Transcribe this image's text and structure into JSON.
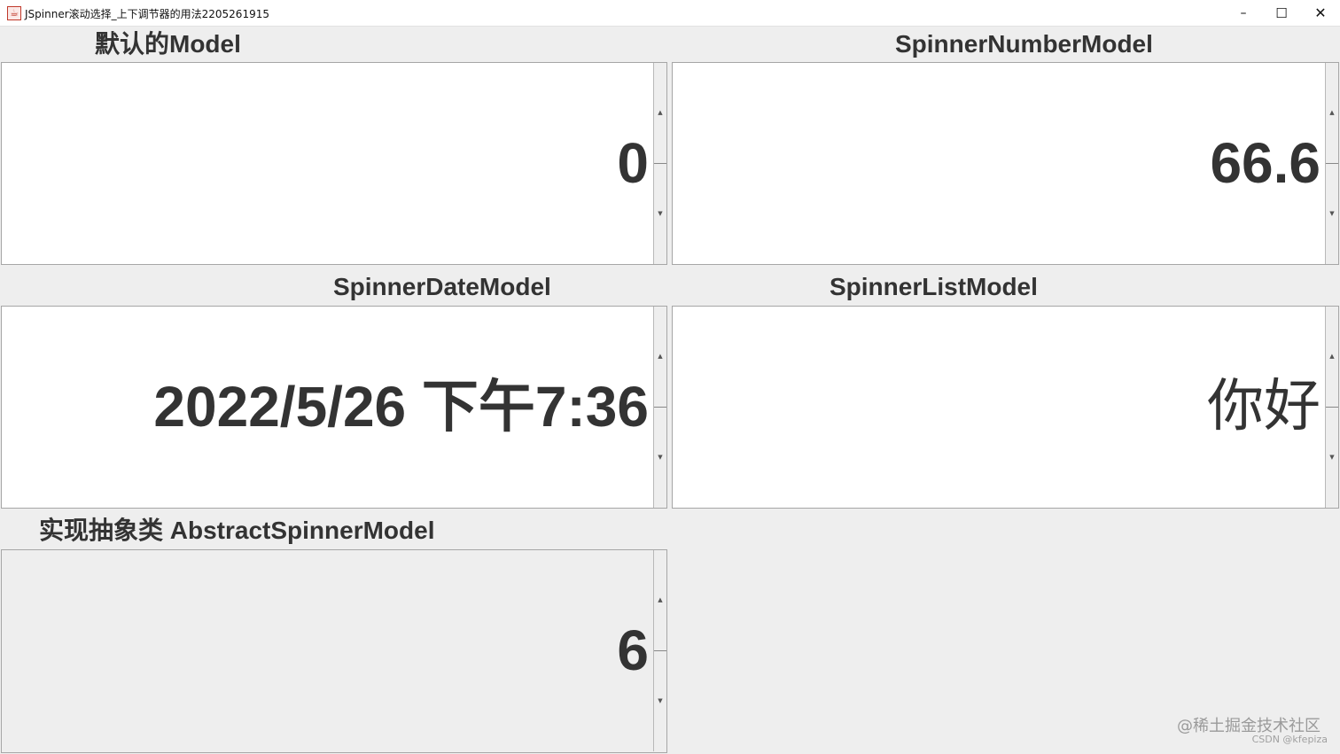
{
  "window": {
    "title": "JSpinner滚动选择_上下调节器的用法2205261915",
    "app_icon": "java-icon",
    "controls": {
      "minimize": "–",
      "maximize": "☐",
      "close": "✕"
    }
  },
  "panels": [
    {
      "title": "默认的Model",
      "value": "0",
      "background": "#ffffff"
    },
    {
      "title": "SpinnerNumberModel",
      "value": "66.6",
      "background": "#ffffff"
    },
    {
      "title": "SpinnerDateModel",
      "value": "2022/5/26 下午7:36",
      "background": "#ffffff"
    },
    {
      "title": "SpinnerListModel",
      "value": "你好",
      "background": "#ffffff"
    },
    {
      "title": "实现抽象类 AbstractSpinnerModel",
      "value": "6",
      "background": "#eeeeee"
    }
  ],
  "spinner_arrows": {
    "up": "▲",
    "down": "▼"
  },
  "watermark": {
    "main": "@稀土掘金技术社区",
    "sub": "CSDN @kfepiza"
  },
  "colors": {
    "window_background": "#eeeeee",
    "text": "#333333",
    "border": "#a6a6a6"
  }
}
